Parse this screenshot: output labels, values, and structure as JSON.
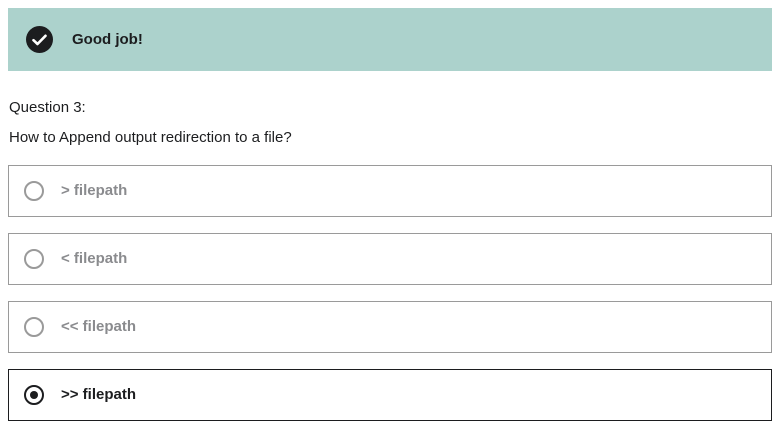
{
  "feedback": {
    "message": "Good job!",
    "icon": "check-circle-icon",
    "background_color": "#acd2cc"
  },
  "question": {
    "number_label": "Question 3:",
    "prompt": "How to Append output redirection to a file?"
  },
  "options": [
    {
      "label": "> filepath",
      "selected": false
    },
    {
      "label": "< filepath",
      "selected": false
    },
    {
      "label": "<< filepath",
      "selected": false
    },
    {
      "label": ">> filepath",
      "selected": true
    }
  ]
}
